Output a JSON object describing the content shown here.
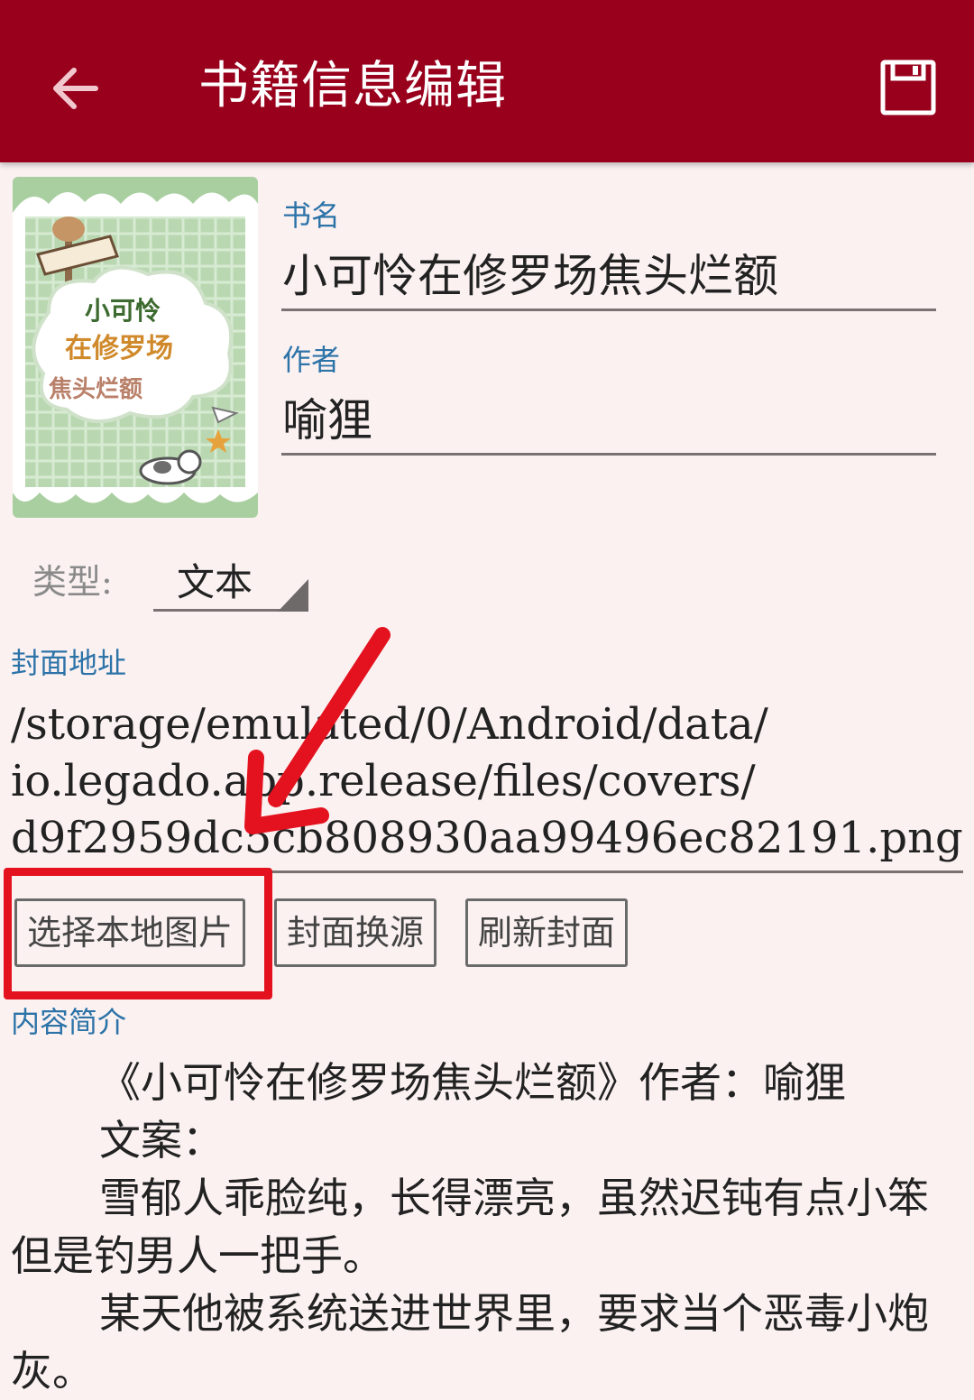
{
  "appbar": {
    "title": "书籍信息编辑",
    "back_icon": "arrow-left-icon",
    "save_icon": "save-icon",
    "bg_color": "#98001c"
  },
  "cover": {
    "title_lines": [
      "小可怜",
      "在修罗场",
      "焦头烂额"
    ]
  },
  "book_name": {
    "label": "书名",
    "value": "小可怜在修罗场焦头烂额"
  },
  "author": {
    "label": "作者",
    "value": "喻狸"
  },
  "type": {
    "label": "类型:",
    "value": "文本"
  },
  "cover_url": {
    "label": "封面地址",
    "value": "/storage/emulated/0/Android/data/\nio.legado.app.release/files/covers/\nd9f2959dc5cb808930aa99496ec82191.png"
  },
  "buttons": {
    "select_local": "选择本地图片",
    "change_source": "封面换源",
    "refresh": "刷新封面"
  },
  "annotation": {
    "color": "#e3121e"
  },
  "intro": {
    "label": "内容简介",
    "paragraphs": [
      "《小可怜在修罗场焦头烂额》作者：喻狸",
      "文案：",
      "雪郁人乖脸纯，长得漂亮，虽然迟钝有点小笨但是钓男人一把手。",
      "某天他被系统送进世界里，要求当个恶毒小炮灰。"
    ]
  }
}
